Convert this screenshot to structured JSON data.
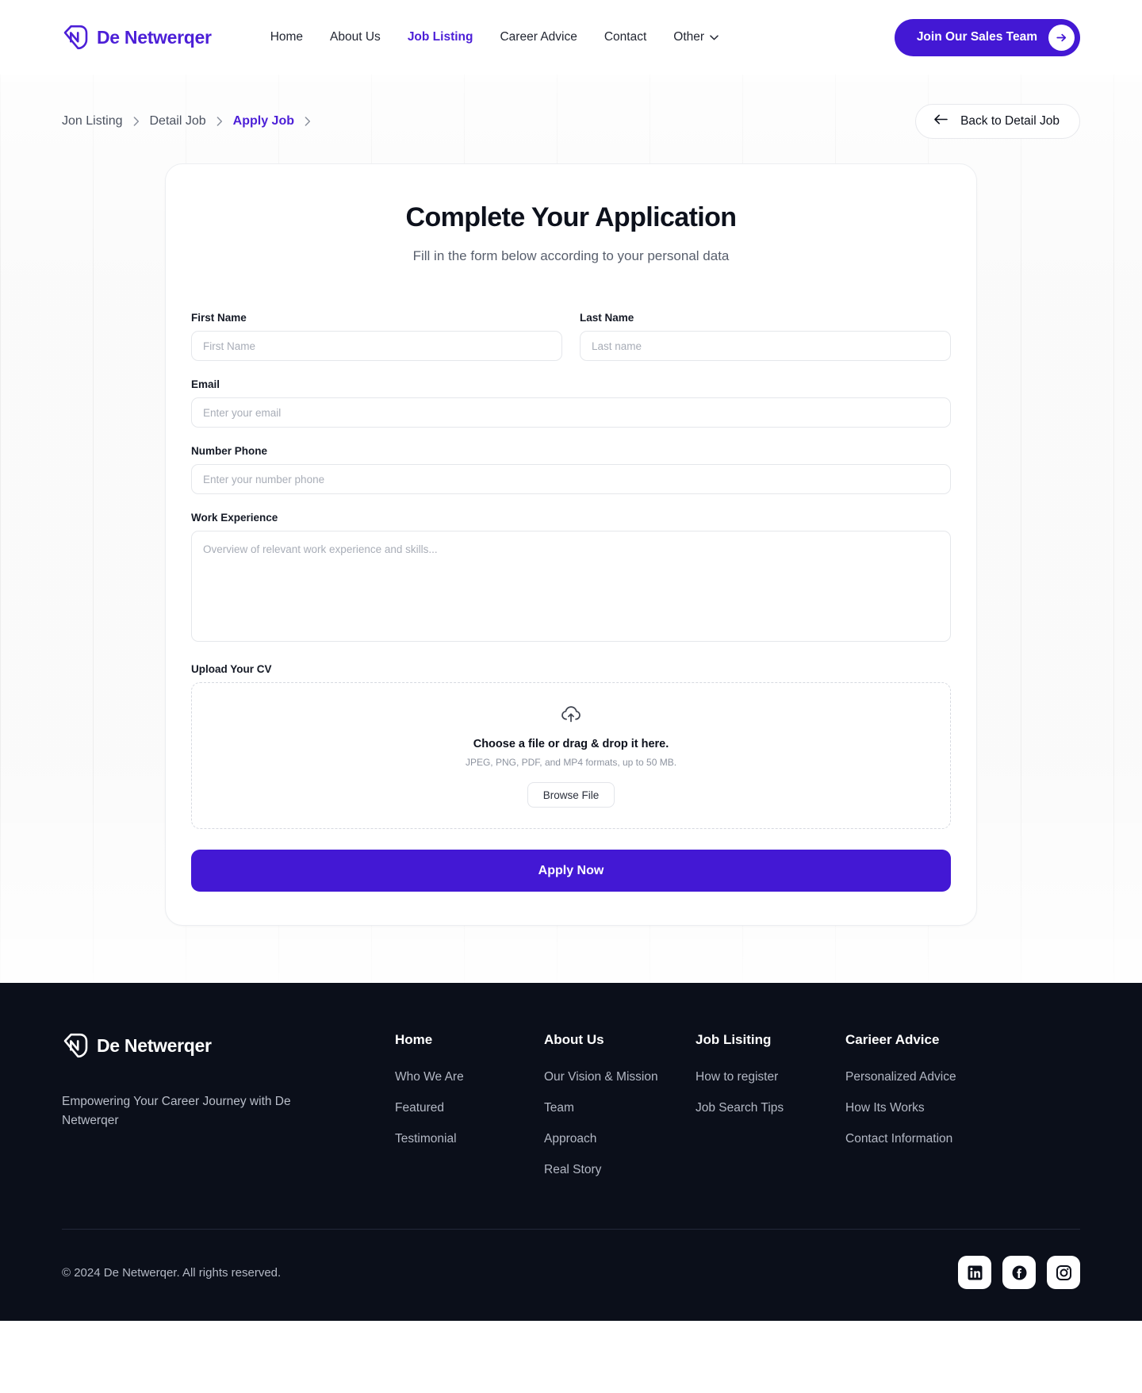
{
  "header": {
    "brand": "De Netwerqer",
    "logo_icon": "n-monogram-logo",
    "nav": [
      {
        "label": "Home",
        "active": false,
        "caret": false
      },
      {
        "label": "About Us",
        "active": false,
        "caret": false
      },
      {
        "label": "Job Listing",
        "active": true,
        "caret": false
      },
      {
        "label": "Career Advice",
        "active": false,
        "caret": false
      },
      {
        "label": "Contact",
        "active": false,
        "caret": false
      },
      {
        "label": "Other",
        "active": false,
        "caret": true
      }
    ],
    "cta_label": "Join Our Sales Team",
    "cta_icon": "arrow-right-icon",
    "accent_color": "#4318d4"
  },
  "topbar": {
    "breadcrumbs": [
      {
        "label": "Jon Listing",
        "current": false
      },
      {
        "label": "Detail Job",
        "current": false
      },
      {
        "label": "Apply Job",
        "current": true
      }
    ],
    "back_label": "Back to Detail Job",
    "back_icon": "arrow-left-icon"
  },
  "card": {
    "title": "Complete Your Application",
    "subtitle": "Fill in the form below according to your personal data",
    "fields": {
      "first_name": {
        "label": "First Name",
        "placeholder": "First Name",
        "value": ""
      },
      "last_name": {
        "label": "Last Name",
        "placeholder": "Last name",
        "value": ""
      },
      "email": {
        "label": "Email",
        "placeholder": "Enter your email",
        "value": ""
      },
      "phone": {
        "label": "Number Phone",
        "placeholder": "Enter your number phone",
        "value": ""
      },
      "work_experience": {
        "label": "Work Experience",
        "placeholder": "Overview of relevant work experience and skills...",
        "value": ""
      },
      "upload_cv": {
        "label": "Upload Your CV"
      }
    },
    "dropzone": {
      "icon": "cloud-upload-icon",
      "title": "Choose a file or drag & drop it here.",
      "subtitle": "JPEG, PNG, PDF, and MP4 formats, up to 50 MB.",
      "browse_label": "Browse File"
    },
    "submit_label": "Apply Now"
  },
  "footer": {
    "brand": "De Netwerqer",
    "logo_icon": "n-monogram-logo",
    "tagline": "Empowering Your Career Journey with De Netwerqer",
    "columns": [
      {
        "heading": "Home",
        "links": [
          "Who We Are",
          "Featured",
          "Testimonial"
        ]
      },
      {
        "heading": "About Us",
        "links": [
          "Our Vision & Mission",
          "Team",
          "Approach",
          "Real Story"
        ]
      },
      {
        "heading": "Job Lisiting",
        "links": [
          "How to register",
          "Job Search Tips"
        ]
      },
      {
        "heading": "Carieer Advice",
        "links": [
          "Personalized Advice",
          "How Its Works",
          "Contact Information"
        ]
      }
    ],
    "copyright": "© 2024  De Netwerqer. All rights reserved.",
    "socials": [
      "linkedin-icon",
      "facebook-icon",
      "instagram-icon"
    ]
  }
}
